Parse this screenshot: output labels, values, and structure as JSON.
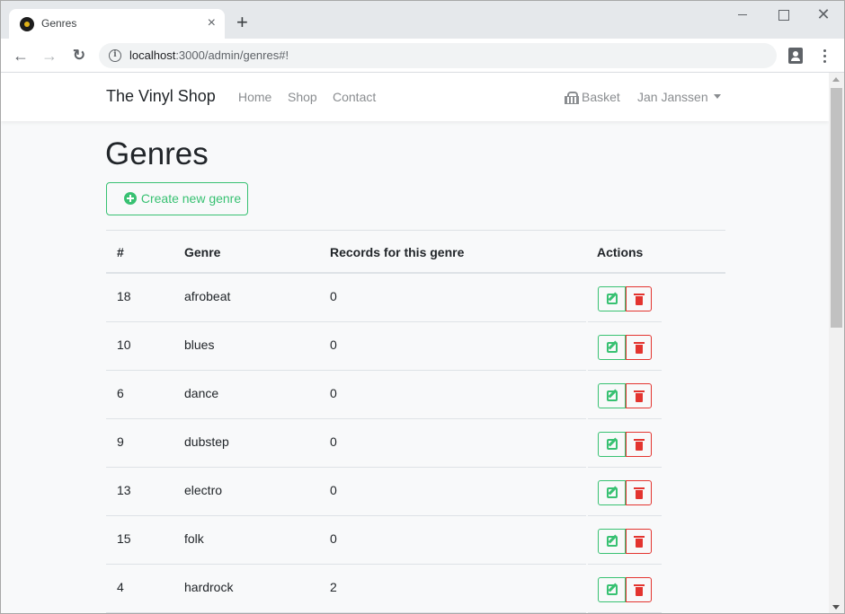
{
  "browser": {
    "tab_title": "Genres",
    "tab_close": "×",
    "new_tab": "+",
    "url_host": "localhost",
    "url_rest": ":3000/admin/genres#!",
    "window_close": "✕"
  },
  "navbar": {
    "brand": "The Vinyl Shop",
    "links": [
      "Home",
      "Shop",
      "Contact"
    ],
    "basket": "Basket",
    "user": "Jan Janssen"
  },
  "page": {
    "title": "Genres",
    "create_button": "Create new genre"
  },
  "table": {
    "headers": [
      "#",
      "Genre",
      "Records for this genre",
      "Actions"
    ],
    "rows": [
      {
        "id": "18",
        "genre": "afrobeat",
        "records": "0"
      },
      {
        "id": "10",
        "genre": "blues",
        "records": "0"
      },
      {
        "id": "6",
        "genre": "dance",
        "records": "0"
      },
      {
        "id": "9",
        "genre": "dubstep",
        "records": "0"
      },
      {
        "id": "13",
        "genre": "electro",
        "records": "0"
      },
      {
        "id": "15",
        "genre": "folk",
        "records": "0"
      },
      {
        "id": "4",
        "genre": "hardrock",
        "records": "2"
      }
    ]
  },
  "colors": {
    "success": "#38c172",
    "danger": "#e3342f"
  }
}
